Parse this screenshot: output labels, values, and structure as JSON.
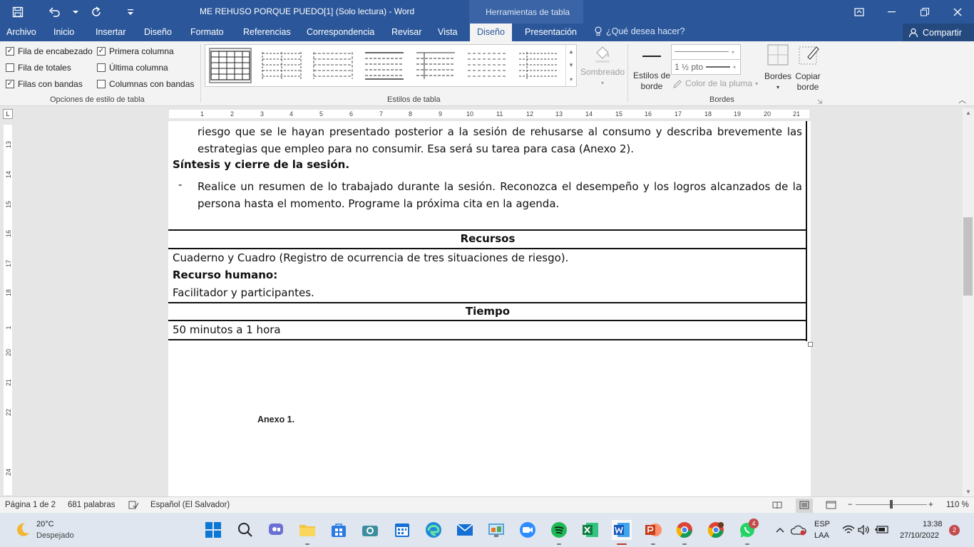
{
  "titlebar": {
    "doc_title": "ME REHUSO PORQUE PUEDO[1] (Solo lectura) - Word",
    "tools_label": "Herramientas de tabla"
  },
  "tabs": [
    "Archivo",
    "Inicio",
    "Insertar",
    "Diseño",
    "Formato",
    "Referencias",
    "Correspondencia",
    "Revisar",
    "Vista",
    "Diseño",
    "Presentación"
  ],
  "tell_me": "¿Qué desea hacer?",
  "share": "Compartir",
  "ribbon": {
    "options": [
      {
        "label": "Fila de encabezado",
        "checked": true
      },
      {
        "label": "Primera columna",
        "checked": true
      },
      {
        "label": "Fila de totales",
        "checked": false
      },
      {
        "label": "Última columna",
        "checked": false
      },
      {
        "label": "Filas con bandas",
        "checked": true
      },
      {
        "label": "Columnas con bandas",
        "checked": false
      }
    ],
    "group_options": "Opciones de estilo de tabla",
    "group_styles": "Estilos de tabla",
    "group_borders": "Bordes",
    "shading": "Sombreado",
    "border_styles_1": "Estilos de",
    "border_styles_2": "borde",
    "line_weight": "1 ½ pto",
    "pen_color": "Color de la pluma",
    "borders_btn": "Bordes",
    "copy_border_1": "Copiar",
    "copy_border_2": "borde"
  },
  "ruler": {
    "h_numbers": [
      "1",
      "2",
      "3",
      "4",
      "5",
      "6",
      "7",
      "8",
      "9",
      "10",
      "11",
      "12",
      "13",
      "14",
      "15",
      "16",
      "17",
      "18",
      "19",
      "20",
      "21"
    ],
    "v_numbers": [
      "13",
      "14",
      "15",
      "16",
      "17",
      "18",
      "1",
      "20",
      "21",
      "22",
      "24"
    ]
  },
  "document": {
    "p1": "riesgo que se le hayan presentado posterior a la sesión de rehusarse al consumo y describa brevemente las estrategias que empleo para no consumir. Esa será su tarea para casa (Anexo 2).",
    "synth_title": "Síntesis y cierre de la sesión.",
    "dash": "-",
    "p2": "Realice un resumen de lo trabajado durante la sesión. Reconozca el desempeño y los logros alcanzados de la persona hasta el momento. Programe la próxima cita en la agenda.",
    "recursos_title": "Recursos",
    "recursos_line": "Cuaderno y Cuadro (Registro de ocurrencia de tres situaciones de riesgo).",
    "recurso_humano": "Recurso humano:",
    "facilitador": "Facilitador y participantes.",
    "tiempo_title": "Tiempo",
    "tiempo_value": "50 minutos a 1 hora",
    "anexo": "Anexo 1."
  },
  "statusbar": {
    "page": "Página 1 de 2",
    "words": "681 palabras",
    "language": "Español (El Salvador)",
    "zoom": "110 %"
  },
  "taskbar": {
    "weather_temp": "20°C",
    "weather_desc": "Despejado",
    "lang_1": "ESP",
    "lang_2": "LAA",
    "time": "13:38",
    "date": "27/10/2022",
    "notif_count": "2",
    "whatsapp_badge": "4"
  },
  "colors": {
    "word_blue": "#2b579a",
    "ribbon_bg": "#f3f3f3",
    "taskbar_bg": "#dfe6f0"
  }
}
